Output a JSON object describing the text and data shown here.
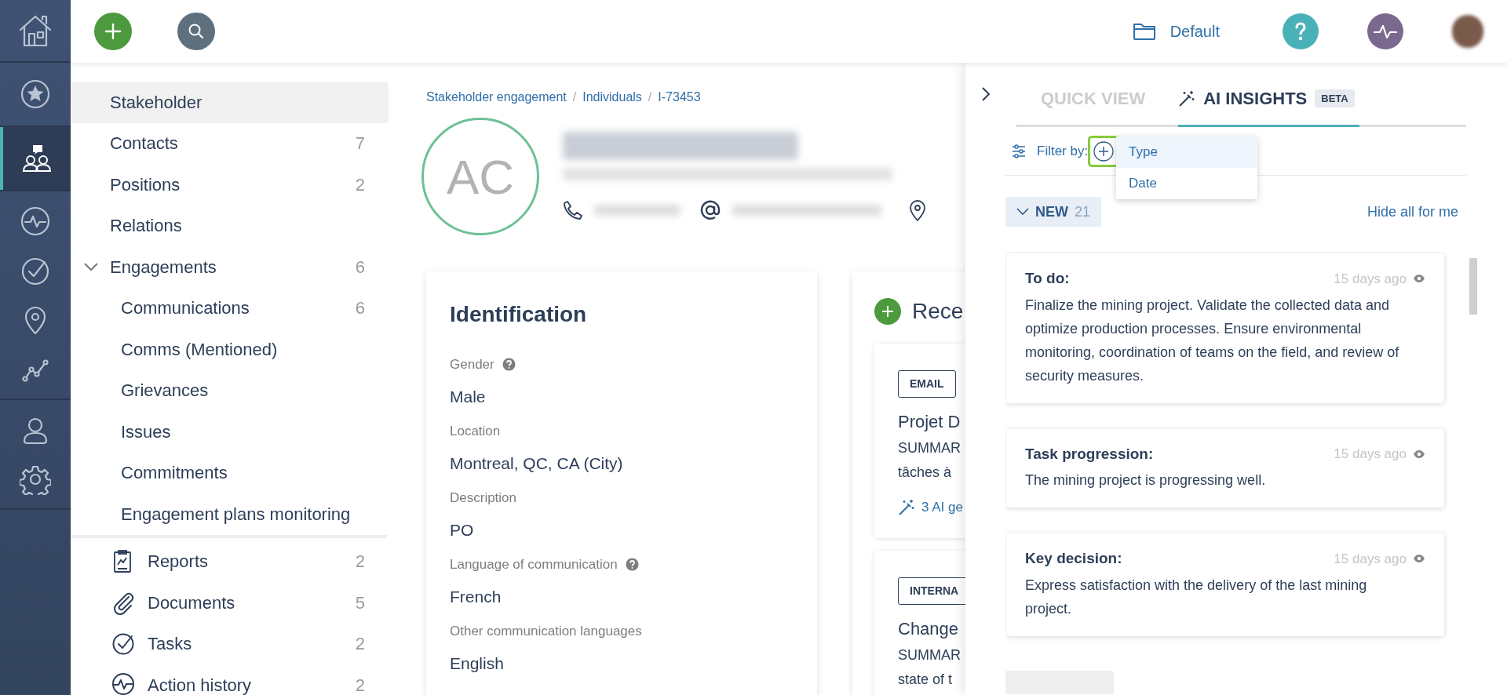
{
  "header": {
    "workspace": "Default"
  },
  "rail": {
    "groups": [
      [
        {
          "selected": false
        }
      ],
      [
        {
          "selected": true
        }
      ],
      [
        {
          "selected": false
        },
        {
          "selected": false
        },
        {
          "selected": false
        },
        {
          "selected": false
        }
      ],
      [
        {
          "selected": false
        },
        {
          "selected": false
        }
      ]
    ]
  },
  "nav": {
    "items": [
      {
        "kind": "plain",
        "label": "Stakeholder",
        "selected": true
      },
      {
        "kind": "plain",
        "label": "Contacts",
        "count": "7",
        "selected": false
      },
      {
        "kind": "plain",
        "label": "Positions",
        "count": "2",
        "selected": false
      },
      {
        "kind": "plain",
        "label": "Relations",
        "selected": false
      },
      {
        "kind": "group",
        "label": "Engagements",
        "count": "6",
        "selected": false,
        "expanded": true,
        "children": [
          {
            "label": "Communications",
            "count": "6",
            "selected": false
          },
          {
            "label": "Comms (Mentioned)",
            "selected": false
          },
          {
            "label": "Grievances",
            "selected": false
          },
          {
            "label": "Issues",
            "selected": false
          },
          {
            "label": "Commitments",
            "selected": false
          },
          {
            "label": "Engagement plans monitoring",
            "selected": false
          }
        ]
      },
      {
        "kind": "tool",
        "label": "Reports",
        "count": "2",
        "selected": false
      },
      {
        "kind": "tool",
        "label": "Documents",
        "count": "5",
        "selected": false
      },
      {
        "kind": "tool",
        "label": "Tasks",
        "count": "2",
        "selected": false
      },
      {
        "kind": "tool",
        "label": "Action history",
        "count": "2",
        "selected": false
      }
    ]
  },
  "breadcrumb": {
    "separator": "/",
    "items": [
      "Stakeholder engagement",
      "Individuals",
      "I-73453"
    ]
  },
  "profile": {
    "initials": "AC"
  },
  "identification": {
    "title": "Identification",
    "fields": [
      {
        "label": "Gender",
        "value": "Male",
        "help": true
      },
      {
        "label": "Location",
        "value": "Montreal, QC, CA (City)",
        "help": false
      },
      {
        "label": "Description",
        "value": "PO",
        "help": false
      },
      {
        "label": "Language of communication",
        "value": "French",
        "help": true
      },
      {
        "label": "Other communication languages",
        "value": "English",
        "help": false
      }
    ]
  },
  "recent": {
    "title": "Rece",
    "items": [
      {
        "tag": "EMAIL",
        "title": "Projet D",
        "lines": [
          "SUMMAR",
          "tâches à"
        ],
        "ai": "3 AI ge"
      },
      {
        "tag": "INTERNA",
        "title": "Change",
        "lines": [
          "SUMMAR",
          "state of t"
        ]
      }
    ]
  },
  "panel": {
    "tabs": [
      {
        "label": "QUICK VIEW",
        "selected": false
      },
      {
        "label": "AI INSIGHTS",
        "badge": "BETA",
        "selected": true
      }
    ],
    "filter": {
      "label": "Filter by:",
      "menu": [
        {
          "label": "Type",
          "selected": true
        },
        {
          "label": "Date",
          "selected": false
        }
      ]
    },
    "section": {
      "label": "NEW",
      "count": "21",
      "expanded": true,
      "action": "Hide all for me"
    },
    "insights": [
      {
        "title": "To do:",
        "time": "15 days ago",
        "text": "Finalize the mining project. Validate the collected data and optimize production processes. Ensure environmental monitoring, coordination of teams on the field, and review of security measures."
      },
      {
        "title": "Task progression:",
        "time": "15 days ago",
        "text": "The mining project is progressing well."
      },
      {
        "title": "Key decision:",
        "time": "15 days ago",
        "text": "Express satisfaction with the delivery of the last mining project."
      }
    ]
  }
}
